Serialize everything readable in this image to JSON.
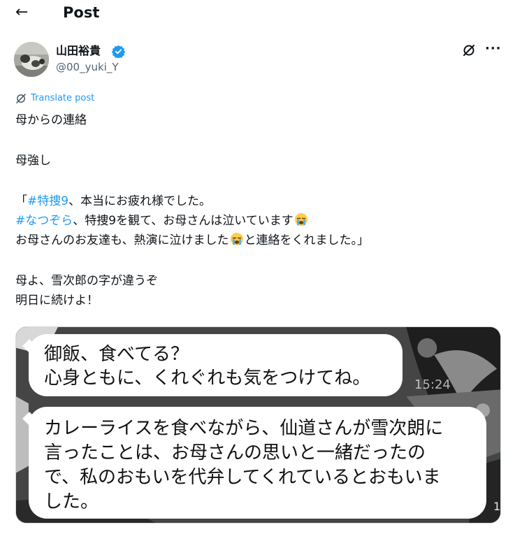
{
  "header": {
    "back_icon": "arrow-left-icon",
    "title": "Post"
  },
  "author": {
    "name": "山田裕貴",
    "handle": "@00_yuki_Y",
    "verified_icon": "verified-badge-icon",
    "verified_color": "#1d9bf0",
    "avatar_icon": "avatar-photo"
  },
  "actions": {
    "grok_icon": "grok-icon",
    "more_icon": "more-horizontal-icon",
    "more_label": "···"
  },
  "translate": {
    "label": "Translate post",
    "icon": "translate-icon"
  },
  "post": {
    "line1": "母からの連絡",
    "line2": "母強し",
    "line3_prefix": "「",
    "line3_hashtag": "#特捜9",
    "line3_rest": "、本当にお疲れ様でした。",
    "line4_hashtag": "#なつぞら",
    "line4_rest": "、特捜9を観て、お母さんは泣いています",
    "line5_part1": "お母さんのお友達も、熱演に泣けました",
    "line5_part2": "と連絡をくれました。」",
    "line6": "母よ、雪次郎の字が違うぞ",
    "line7": "明日に続けよ！",
    "emoji_icon": "loudly-crying-face-emoji",
    "hashtag_color": "#1d9bf0"
  },
  "media": {
    "bubble1_line1": "御飯、食べてる？",
    "bubble1_line2": "心身ともに、くれぐれも気をつけてね。",
    "bubble2_line1": "カレーライスを食べながら、仙道さんが雪次朗に",
    "bubble2_line2": "言ったことは、お母さんの思いと一緒だったの",
    "bubble2_line3": "で、私のおもいを代弁してくれているとおもいま",
    "bubble2_line4": "した。",
    "time": "15:24",
    "corner_number": "1"
  }
}
